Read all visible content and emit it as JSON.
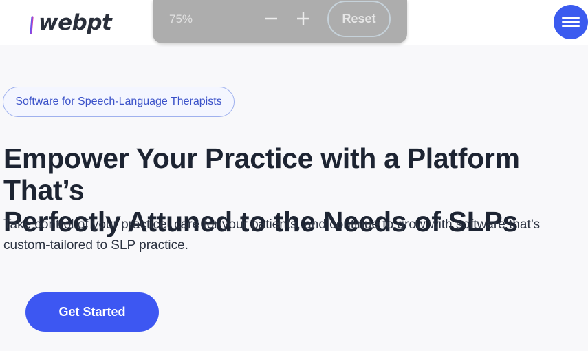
{
  "header": {
    "logo_text": "webpt",
    "menu_icon": "hamburger-icon",
    "accent_color": "#3b5bef"
  },
  "zoom_controls": {
    "level": "75%",
    "zoom_out_icon": "minus-icon",
    "zoom_in_icon": "plus-icon",
    "reset_label": "Reset"
  },
  "hero": {
    "tag": "Software for Speech-Language Therapists",
    "headline_line1": "Empower Your Practice with a Platform That’s",
    "headline_line2": "Perfectly Attuned to the Needs of SLPs",
    "subtext_line1": "Take control of your practice, care for your patients, and continue to grow with software that’s",
    "subtext_line2": "custom-tailored to SLP practice.",
    "cta_label": "Get Started"
  }
}
